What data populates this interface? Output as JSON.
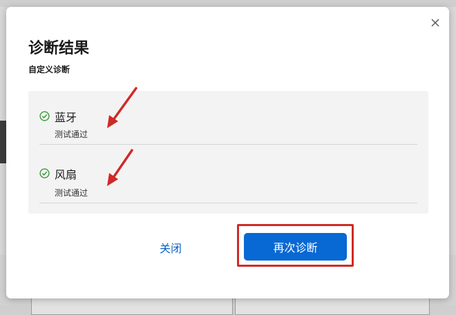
{
  "dialog": {
    "title": "诊断结果",
    "subtitle": "自定义诊断",
    "close_icon": "close-icon",
    "results": [
      {
        "name": "蓝牙",
        "status": "测试通过",
        "icon": "check-circle-icon"
      },
      {
        "name": "风扇",
        "status": "测试通过",
        "icon": "check-circle-icon"
      }
    ],
    "actions": {
      "close_label": "关闭",
      "rediagnose_label": "再次诊断"
    }
  },
  "colors": {
    "primary": "#0868d4",
    "link": "#0a63c4",
    "success": "#3a9a3a",
    "annotation": "#cf2a27",
    "panel": "#f3f3f3"
  }
}
